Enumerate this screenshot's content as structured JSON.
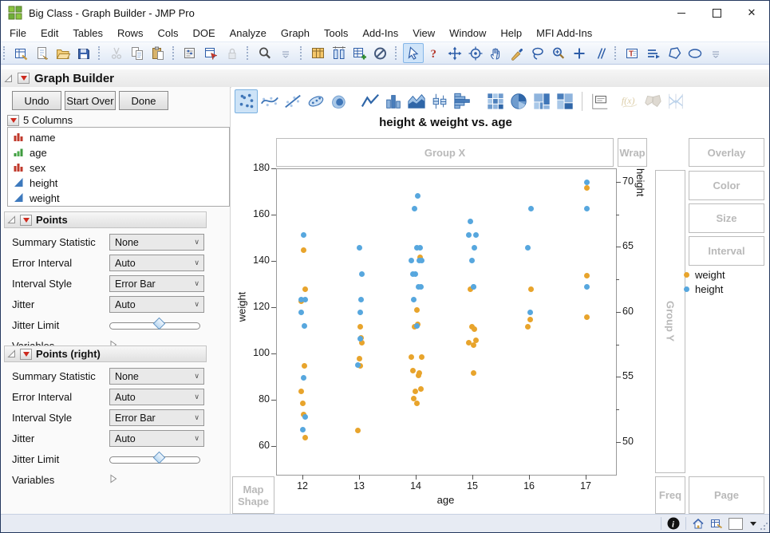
{
  "window": {
    "title": "Big Class - Graph Builder - JMP Pro",
    "controls": [
      {
        "name": "minimize"
      },
      {
        "name": "maximize"
      },
      {
        "name": "close"
      }
    ]
  },
  "menu_bar": {
    "items": [
      "File",
      "Edit",
      "Tables",
      "Rows",
      "Cols",
      "DOE",
      "Analyze",
      "Graph",
      "Tools",
      "Add-Ins",
      "View",
      "Window",
      "Help",
      "MFI Add-Ins"
    ]
  },
  "toolbar": {
    "groups": [
      {
        "icons": [
          {
            "name": "new-data-table"
          },
          {
            "name": "new-journal"
          },
          {
            "name": "open"
          },
          {
            "name": "save"
          }
        ]
      },
      {
        "icons": [
          {
            "name": "cut",
            "disabled": true
          },
          {
            "name": "copy"
          },
          {
            "name": "paste"
          }
        ]
      },
      {
        "icons": [
          {
            "name": "preferences"
          },
          {
            "name": "script-window"
          },
          {
            "name": "lock",
            "disabled": true
          }
        ]
      },
      {
        "icons": [
          {
            "name": "search"
          },
          {
            "name": "toolbar-overflow"
          }
        ]
      },
      {
        "icons": [
          {
            "name": "data-table"
          },
          {
            "name": "column-widths"
          },
          {
            "name": "add-rows"
          },
          {
            "name": "exclude"
          }
        ]
      },
      {
        "icons": [
          {
            "name": "arrow-cursor",
            "selected": true
          },
          {
            "name": "help"
          },
          {
            "name": "move-tool"
          },
          {
            "name": "bullseye"
          },
          {
            "name": "grabber-hand"
          },
          {
            "name": "brush"
          },
          {
            "name": "lasso"
          },
          {
            "name": "zoom-in"
          },
          {
            "name": "plus-tool"
          },
          {
            "name": "line-segment-tool"
          }
        ]
      },
      {
        "icons": [
          {
            "name": "text-annotation"
          },
          {
            "name": "line-annotation"
          },
          {
            "name": "polygon-annotation"
          },
          {
            "name": "oval-annotation"
          },
          {
            "name": "toolbar-overflow"
          }
        ]
      }
    ]
  },
  "graph_builder": {
    "header": "Graph Builder",
    "buttons": [
      {
        "label": "Undo"
      },
      {
        "label": "Start Over"
      },
      {
        "label": "Done"
      }
    ],
    "columns_panel": {
      "label": "5 Columns",
      "columns": [
        {
          "name": "name",
          "type": "nominal"
        },
        {
          "name": "age",
          "type": "ordinal"
        },
        {
          "name": "sex",
          "type": "nominal"
        },
        {
          "name": "height",
          "type": "continuous"
        },
        {
          "name": "weight",
          "type": "continuous"
        }
      ]
    },
    "panels": [
      {
        "title": "Points",
        "rows": [
          {
            "label": "Summary Statistic",
            "control": "select",
            "value": "None"
          },
          {
            "label": "Error Interval",
            "control": "select",
            "value": "Auto"
          },
          {
            "label": "Interval Style",
            "control": "select",
            "value": "Error Bar"
          },
          {
            "label": "Jitter",
            "control": "select",
            "value": "Auto"
          },
          {
            "label": "Jitter Limit",
            "control": "slider",
            "value": 0.55
          },
          {
            "label": "Variables",
            "control": "disclosure"
          }
        ]
      },
      {
        "title": "Points (right)",
        "rows": [
          {
            "label": "Summary Statistic",
            "control": "select",
            "value": "None"
          },
          {
            "label": "Error Interval",
            "control": "select",
            "value": "Auto"
          },
          {
            "label": "Interval Style",
            "control": "select",
            "value": "Error Bar"
          },
          {
            "label": "Jitter",
            "control": "select",
            "value": "Auto"
          },
          {
            "label": "Jitter Limit",
            "control": "slider",
            "value": 0.55
          },
          {
            "label": "Variables",
            "control": "disclosure"
          }
        ]
      }
    ]
  },
  "palette": {
    "items": [
      {
        "name": "points",
        "selected": true
      },
      {
        "name": "smoother"
      },
      {
        "name": "line-of-fit"
      },
      {
        "name": "ellipse"
      },
      {
        "name": "contour"
      },
      {
        "name": "line",
        "gap_before": 10
      },
      {
        "name": "bar"
      },
      {
        "name": "area"
      },
      {
        "name": "box-plot"
      },
      {
        "name": "histogram"
      },
      {
        "name": "heatmap",
        "gap_before": 12
      },
      {
        "name": "pie"
      },
      {
        "name": "treemap"
      },
      {
        "name": "mosaic"
      },
      {
        "name": "caption-box",
        "divider_before": true
      },
      {
        "name": "formula",
        "disabled": true,
        "gap_before": 8
      },
      {
        "name": "map-shapes",
        "disabled": true
      },
      {
        "name": "parallel",
        "disabled": true
      }
    ]
  },
  "drop_zones": {
    "group_x": "Group X",
    "wrap": "Wrap",
    "overlay": "Overlay",
    "color": "Color",
    "size": "Size",
    "interval": "Interval",
    "group_y": "Group Y",
    "map_shape": "Map Shape",
    "freq": "Freq",
    "page": "Page"
  },
  "legend": {
    "items": [
      {
        "label": "weight",
        "color": "#E8A42C"
      },
      {
        "label": "height",
        "color": "#57A7DE"
      }
    ]
  },
  "chart_data": {
    "type": "scatter",
    "title": "height & weight vs. age",
    "xlabel": "age",
    "x_ticks": [
      12,
      13,
      14,
      15,
      16,
      17
    ],
    "x_range": [
      11.535,
      17.52
    ],
    "grid": false,
    "left_axis": {
      "label": "weight",
      "ticks": [
        180,
        160,
        140,
        120,
        100,
        80,
        60
      ],
      "top_value": 180,
      "bottom_value": 48
    },
    "right_axis": {
      "label": "height",
      "ticks": [
        70,
        65,
        60,
        55,
        50
      ],
      "minor_ticks": [
        67.5,
        62.5,
        57.5,
        52.5
      ],
      "top_value": 71.04,
      "bottom_value": 47.54
    },
    "series": [
      {
        "name": "weight",
        "axis": "left",
        "color": "#E8A42C",
        "points": [
          [
            12.02,
            95
          ],
          [
            11.96,
            123
          ],
          [
            12.01,
            74
          ],
          [
            12,
            145
          ],
          [
            12.03,
            64
          ],
          [
            11.97,
            84
          ],
          [
            12.04,
            128
          ],
          [
            11.99,
            79
          ],
          [
            13,
            112
          ],
          [
            13.02,
            107
          ],
          [
            12.97,
            67
          ],
          [
            12.99,
            98
          ],
          [
            13.03,
            105
          ],
          [
            13,
            95
          ],
          [
            14,
            79
          ],
          [
            13.95,
            81
          ],
          [
            14.04,
            91
          ],
          [
            14.06,
            142
          ],
          [
            13.98,
            84
          ],
          [
            14.07,
            85
          ],
          [
            13.94,
            93
          ],
          [
            13.91,
            99
          ],
          [
            14,
            119
          ],
          [
            14.05,
            92
          ],
          [
            13.97,
            112
          ],
          [
            14.09,
            99
          ],
          [
            14.02,
            113
          ],
          [
            15,
            92
          ],
          [
            14.98,
            112
          ],
          [
            14.95,
            128
          ],
          [
            15.02,
            111
          ],
          [
            14.92,
            105
          ],
          [
            15.01,
            104
          ],
          [
            15.05,
            106
          ],
          [
            15.97,
            112
          ],
          [
            16.01,
            115
          ],
          [
            16.02,
            128
          ],
          [
            17,
            116
          ],
          [
            17.01,
            134
          ],
          [
            17,
            172
          ]
        ]
      },
      {
        "name": "height",
        "axis": "right",
        "color": "#57A7DE",
        "points": [
          [
            12.02,
            59
          ],
          [
            11.96,
            61
          ],
          [
            12.01,
            55
          ],
          [
            12,
            66
          ],
          [
            12.03,
            52
          ],
          [
            11.97,
            60
          ],
          [
            12.04,
            61
          ],
          [
            11.99,
            51
          ],
          [
            13,
            60
          ],
          [
            13.02,
            61
          ],
          [
            12.97,
            56
          ],
          [
            12.99,
            65
          ],
          [
            13.03,
            63
          ],
          [
            13,
            58
          ],
          [
            14,
            59
          ],
          [
            13.95,
            61
          ],
          [
            14.04,
            62
          ],
          [
            14.06,
            65
          ],
          [
            13.98,
            63
          ],
          [
            14.07,
            62
          ],
          [
            13.94,
            63
          ],
          [
            13.91,
            64
          ],
          [
            14,
            65
          ],
          [
            14.05,
            64
          ],
          [
            13.97,
            68
          ],
          [
            14.09,
            64
          ],
          [
            14.02,
            69
          ],
          [
            15,
            62
          ],
          [
            14.98,
            64
          ],
          [
            14.95,
            67
          ],
          [
            15.02,
            65
          ],
          [
            14.92,
            66
          ],
          [
            15.01,
            62
          ],
          [
            15.05,
            66
          ],
          [
            15.97,
            65
          ],
          [
            16.01,
            60
          ],
          [
            16.02,
            68
          ],
          [
            17,
            62
          ],
          [
            17.01,
            68
          ],
          [
            17,
            70
          ]
        ]
      }
    ]
  },
  "status_bar": {
    "icons": [
      {
        "name": "info-circle"
      },
      {
        "name": "home"
      },
      {
        "name": "window-manager"
      },
      {
        "name": "display-swatch"
      },
      {
        "name": "caret-down"
      }
    ]
  }
}
